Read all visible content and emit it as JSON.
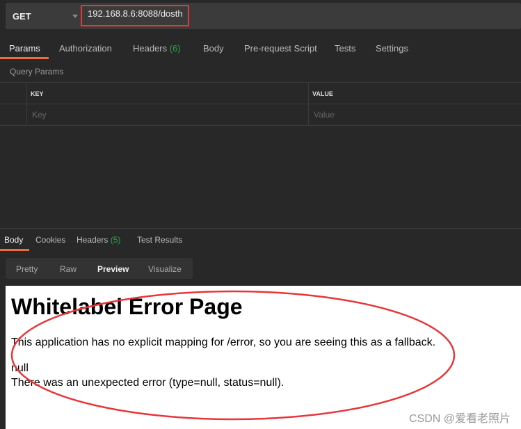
{
  "request": {
    "method": "GET",
    "url": "192.168.8.6:8088/dosth"
  },
  "tabs": [
    {
      "label": "Params"
    },
    {
      "label": "Authorization"
    },
    {
      "label": "Headers",
      "count": "(6)"
    },
    {
      "label": "Body"
    },
    {
      "label": "Pre-request Script"
    },
    {
      "label": "Tests"
    },
    {
      "label": "Settings"
    }
  ],
  "query_params": {
    "title": "Query Params",
    "key_header": "KEY",
    "value_header": "VALUE",
    "key_placeholder": "Key",
    "value_placeholder": "Value"
  },
  "response_tabs": [
    {
      "label": "Body"
    },
    {
      "label": "Cookies"
    },
    {
      "label": "Headers",
      "count": "(5)"
    },
    {
      "label": "Test Results"
    }
  ],
  "view_modes": [
    "Pretty",
    "Raw",
    "Preview",
    "Visualize"
  ],
  "preview": {
    "title": "Whitelabel Error Page",
    "line1": "This application has no explicit mapping for /error, so you are seeing this as a fallback.",
    "line2": "null",
    "line3": "There was an unexpected error (type=null, status=null)."
  },
  "watermark": "CSDN @爱看老照片",
  "colors": {
    "accent": "#f26b3a",
    "annotation": "#e8363a",
    "count": "#28a745"
  }
}
